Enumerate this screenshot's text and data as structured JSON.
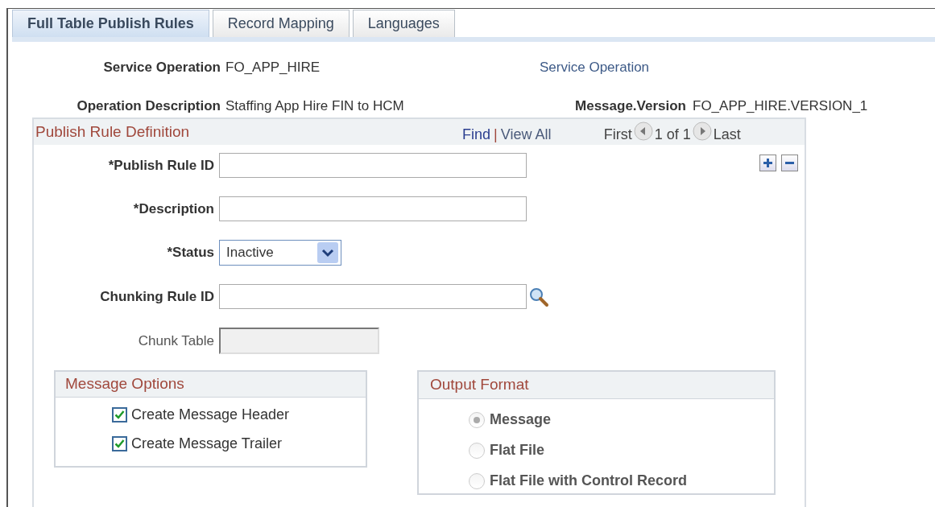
{
  "tabs": [
    {
      "label": "Full Table Publish Rules",
      "selected": true
    },
    {
      "label": "Record Mapping",
      "selected": false
    },
    {
      "label": "Languages",
      "selected": false
    }
  ],
  "service_operation": {
    "label": "Service Operation",
    "value": "FO_APP_HIRE",
    "link": "Service Operation"
  },
  "operation_description": {
    "label": "Operation Description",
    "value": "Staffing App Hire FIN to HCM"
  },
  "message_version": {
    "label": "Message.Version",
    "value": "FO_APP_HIRE.VERSION_1"
  },
  "publish_rule_definition": {
    "title": "Publish Rule Definition",
    "find": "Find",
    "separator": "|",
    "view_all": "View All",
    "first": "First",
    "count": "1 of 1",
    "last": "Last",
    "fields": [
      {
        "kind": "text",
        "label": "*Publish Rule ID"
      },
      {
        "kind": "text",
        "label": "*Description"
      },
      {
        "kind": "select",
        "label": "*Status",
        "value": "Inactive"
      },
      {
        "kind": "lookup",
        "label": "Chunking Rule ID"
      },
      {
        "kind": "readonly",
        "label": "Chunk Table"
      }
    ],
    "message_options": {
      "title": "Message Options",
      "items": [
        {
          "label": "Create Message Header",
          "checked": true
        },
        {
          "label": "Create Message Trailer",
          "checked": true
        }
      ]
    },
    "output_format": {
      "title": "Output Format",
      "items": [
        {
          "label": "Message",
          "selected": true
        },
        {
          "label": "Flat File",
          "selected": false
        },
        {
          "label": "Flat File with Control Record",
          "selected": false
        }
      ]
    }
  }
}
